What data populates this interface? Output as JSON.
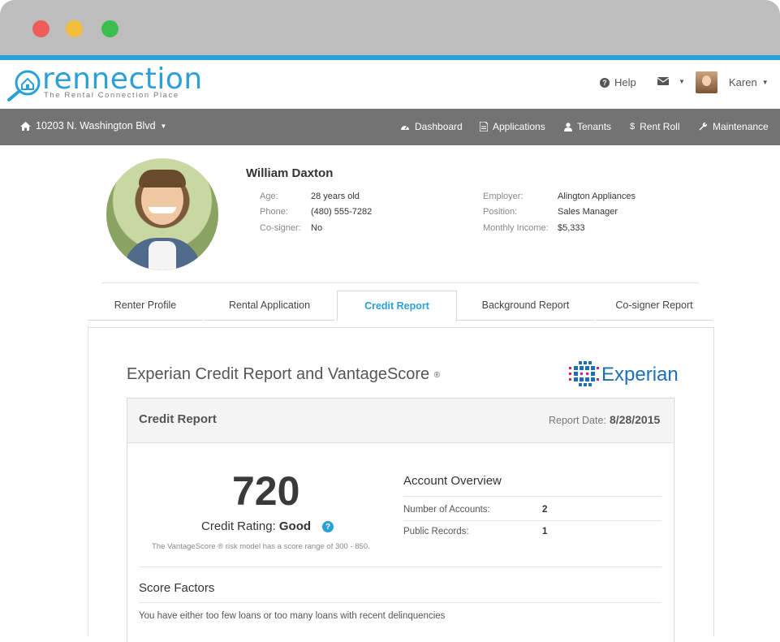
{
  "colors": {
    "accent": "#2aa0d8",
    "navbar": "#737373",
    "chrome": "#bdbdbd",
    "close": "#ee5c5c",
    "minimize": "#f4bd3b",
    "maximize": "#3bbf4c"
  },
  "brand": {
    "name": "rennection",
    "tagline": "The Rental Connection Place"
  },
  "header": {
    "help_label": "Help",
    "user_name": "Karen"
  },
  "nav": {
    "property": "10203 N. Washington Blvd",
    "items": [
      {
        "label": "Dashboard",
        "icon": "dashboard-icon"
      },
      {
        "label": "Applications",
        "icon": "document-icon"
      },
      {
        "label": "Tenants",
        "icon": "user-icon"
      },
      {
        "label": "Rent Roll",
        "icon": "dollar-icon"
      },
      {
        "label": "Maintenance",
        "icon": "wrench-icon"
      }
    ]
  },
  "profile": {
    "name": "William Daxton",
    "left": [
      {
        "label": "Age:",
        "value": "28 years old"
      },
      {
        "label": "Phone:",
        "value": "(480) 555-7282"
      },
      {
        "label": "Co-signer:",
        "value": "No"
      }
    ],
    "right": [
      {
        "label": "Employer:",
        "value": "Alington Appliances"
      },
      {
        "label": "Position:",
        "value": "Sales Manager"
      },
      {
        "label": "Monthly Income:",
        "value": "$5,333"
      }
    ]
  },
  "tabs": [
    "Renter Profile",
    "Rental Application",
    "Credit Report",
    "Background Report",
    "Co-signer Report"
  ],
  "report": {
    "title": "Experian Credit Report and VantageScore",
    "reg_mark": "®",
    "provider": "Experian",
    "panel_title": "Credit Report",
    "date_label": "Report Date:",
    "date": "8/28/2015",
    "score": "720",
    "rating_label": "Credit Rating:",
    "rating": "Good",
    "help_mark": "?",
    "note": "The VantageScore ® risk model has a score range of 300 - 850.",
    "overview_title": "Account Overview",
    "overview": [
      {
        "label": "Number of Accounts:",
        "value": "2"
      },
      {
        "label": "Public Records:",
        "value": "1"
      }
    ],
    "factors_title": "Score Factors",
    "factors": [
      "You have either too few loans or too many loans with recent delinquencies"
    ]
  }
}
